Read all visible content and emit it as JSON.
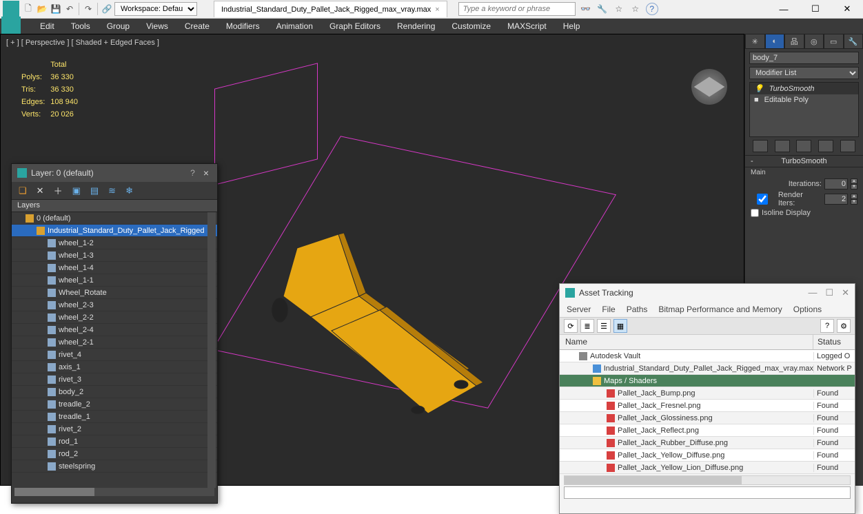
{
  "titlebar": {
    "workspace_label": "Workspace: Default",
    "tab_title": "Industrial_Standard_Duty_Pallet_Jack_Rigged_max_vray.max",
    "search_placeholder": "Type a keyword or phrase"
  },
  "menu": [
    "Edit",
    "Tools",
    "Group",
    "Views",
    "Create",
    "Modifiers",
    "Animation",
    "Graph Editors",
    "Rendering",
    "Customize",
    "MAXScript",
    "Help"
  ],
  "viewport": {
    "label": "[ + ] [ Perspective ] [ Shaded + Edged Faces ]",
    "stats": {
      "header": "Total",
      "polys_label": "Polys:",
      "polys": "36 330",
      "tris_label": "Tris:",
      "tris": "36 330",
      "edges_label": "Edges:",
      "edges": "108 940",
      "verts_label": "Verts:",
      "verts": "20 026"
    }
  },
  "cmdpanel": {
    "object_name": "body_7",
    "modifier_list": "Modifier List",
    "stack": [
      "TurboSmooth",
      "Editable Poly"
    ],
    "rollout": "TurboSmooth",
    "section_main": "Main",
    "iterations_label": "Iterations:",
    "iterations": "0",
    "render_iters_label": "Render Iters:",
    "render_iters": "2",
    "isoline_label": "Isoline Display"
  },
  "layerpanel": {
    "title": "Layer: 0 (default)",
    "header": "Layers",
    "items": [
      {
        "depth": 0,
        "label": "0 (default)"
      },
      {
        "depth": 1,
        "label": "Industrial_Standard_Duty_Pallet_Jack_Rigged",
        "selected": true
      },
      {
        "depth": 2,
        "label": "wheel_1-2"
      },
      {
        "depth": 2,
        "label": "wheel_1-3"
      },
      {
        "depth": 2,
        "label": "wheel_1-4"
      },
      {
        "depth": 2,
        "label": "wheel_1-1"
      },
      {
        "depth": 2,
        "label": "Wheel_Rotate"
      },
      {
        "depth": 2,
        "label": "wheel_2-3"
      },
      {
        "depth": 2,
        "label": "wheel_2-2"
      },
      {
        "depth": 2,
        "label": "wheel_2-4"
      },
      {
        "depth": 2,
        "label": "wheel_2-1"
      },
      {
        "depth": 2,
        "label": "rivet_4"
      },
      {
        "depth": 2,
        "label": "axis_1"
      },
      {
        "depth": 2,
        "label": "rivet_3"
      },
      {
        "depth": 2,
        "label": "body_2"
      },
      {
        "depth": 2,
        "label": "treadle_2"
      },
      {
        "depth": 2,
        "label": "treadle_1"
      },
      {
        "depth": 2,
        "label": "rivet_2"
      },
      {
        "depth": 2,
        "label": "rod_1"
      },
      {
        "depth": 2,
        "label": "rod_2"
      },
      {
        "depth": 2,
        "label": "steelspring"
      }
    ]
  },
  "assetpanel": {
    "title": "Asset Tracking",
    "menu": [
      "Server",
      "File",
      "Paths",
      "Bitmap Performance and Memory",
      "Options"
    ],
    "col_name": "Name",
    "col_status": "Status",
    "rows": [
      {
        "indent": 1,
        "icon": "vault",
        "name": "Autodesk Vault",
        "status": "Logged O"
      },
      {
        "indent": 2,
        "icon": "file",
        "name": "Industrial_Standard_Duty_Pallet_Jack_Rigged_max_vray.max",
        "status": "Network P"
      },
      {
        "indent": 2,
        "icon": "section",
        "name": "Maps / Shaders",
        "status": "",
        "section": true
      },
      {
        "indent": 3,
        "icon": "png",
        "name": "Pallet_Jack_Bump.png",
        "status": "Found"
      },
      {
        "indent": 3,
        "icon": "png",
        "name": "Pallet_Jack_Fresnel.png",
        "status": "Found"
      },
      {
        "indent": 3,
        "icon": "png",
        "name": "Pallet_Jack_Glossiness.png",
        "status": "Found"
      },
      {
        "indent": 3,
        "icon": "png",
        "name": "Pallet_Jack_Reflect.png",
        "status": "Found"
      },
      {
        "indent": 3,
        "icon": "png",
        "name": "Pallet_Jack_Rubber_Diffuse.png",
        "status": "Found"
      },
      {
        "indent": 3,
        "icon": "png",
        "name": "Pallet_Jack_Yellow_Diffuse.png",
        "status": "Found"
      },
      {
        "indent": 3,
        "icon": "png",
        "name": "Pallet_Jack_Yellow_Lion_Diffuse.png",
        "status": "Found"
      }
    ]
  }
}
